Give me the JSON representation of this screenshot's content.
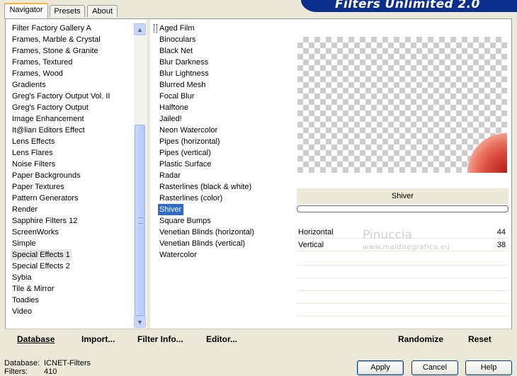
{
  "tabs": [
    "Navigator",
    "Presets",
    "About"
  ],
  "app_title": "Filters Unlimited 2.0",
  "categories": [
    "Filter Factory Gallery A",
    "Frames, Marble & Crystal",
    "Frames, Stone & Granite",
    "Frames, Textured",
    "Frames, Wood",
    "Gradients",
    "Greg's Factory Output Vol. II",
    "Greg's Factory Output",
    "Image Enhancement",
    "It@lian Editors Effect",
    "Lens Effects",
    "Lens Flares",
    "Noise Filters",
    "Paper Backgrounds",
    "Paper Textures",
    "Pattern Generators",
    "Render",
    "Sapphire Filters 12",
    "ScreenWorks",
    "Simple",
    "Special Effects 1",
    "Special Effects 2",
    "Sybia",
    "Tile & Mirror",
    "Toadies",
    "Video"
  ],
  "selected_category": "Special Effects 1",
  "filters": [
    "Aged Film",
    "Binoculars",
    "Black Net",
    "Blur Darkness",
    "Blur Lightness",
    "Blurred Mesh",
    "Focal Blur",
    "Halftone",
    "Jailed!",
    "Neon Watercolor",
    "Pipes (horizontal)",
    "Pipes (vertical)",
    "Plastic Surface",
    "Radar",
    "Rasterlines (black & white)",
    "Rasterlines (color)",
    "Shiver",
    "Square Bumps",
    "Venetian Blinds (horizontal)",
    "Venetian Blinds (vertical)",
    "Watercolor"
  ],
  "selected_filter": "Shiver",
  "current_filter_name": "Shiver",
  "params": [
    {
      "label": "Horizontal",
      "value": "44"
    },
    {
      "label": "Vertical",
      "value": "38"
    }
  ],
  "watermark": {
    "name": "Pinuccia",
    "url": "www.maidiregrafica.eu"
  },
  "toolbar": {
    "database": "Database",
    "import": "Import...",
    "filter_info": "Filter Info...",
    "editor": "Editor...",
    "randomize": "Randomize",
    "reset": "Reset"
  },
  "status": {
    "database_label": "Database:",
    "database_value": "ICNET-Filters",
    "filters_label": "Filters:",
    "filters_value": "410"
  },
  "buttons": {
    "apply": "Apply",
    "cancel": "Cancel",
    "help": "Help"
  },
  "colors": {
    "selection": "#316ac5",
    "banner": "#0a2f8c",
    "face": "#ece9d8"
  }
}
